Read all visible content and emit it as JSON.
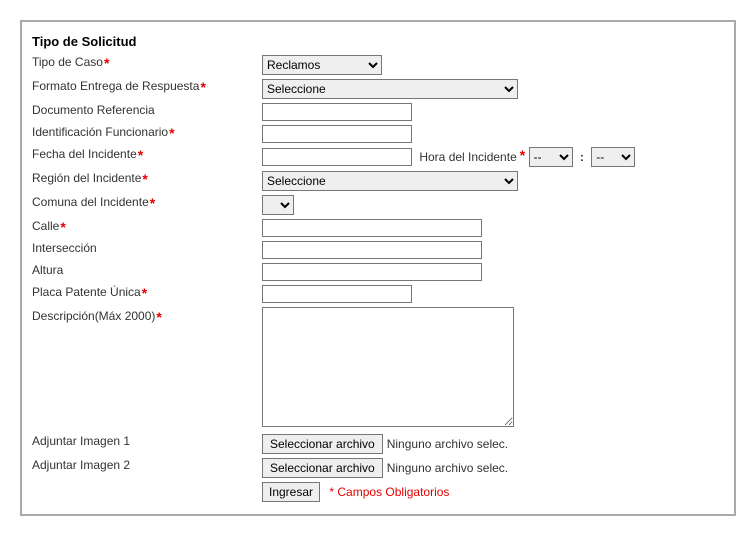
{
  "section_title": "Tipo de Solicitud",
  "labels": {
    "tipo_caso": "Tipo de Caso",
    "formato_entrega": "Formato Entrega de Respuesta",
    "documento_ref": "Documento Referencia",
    "id_funcionario": "Identificación Funcionario",
    "fecha_incidente": "Fecha del Incidente",
    "hora_incidente": "Hora del Incidente",
    "region_incidente": "Región del Incidente",
    "comuna_incidente": "Comuna del Incidente",
    "calle": "Calle",
    "interseccion": "Intersección",
    "altura": "Altura",
    "placa": "Placa Patente Única",
    "descripcion": "Descripción(Máx 2000)",
    "adj_img1": "Adjuntar Imagen 1",
    "adj_img2": "Adjuntar Imagen 2"
  },
  "values": {
    "tipo_caso_selected": "Reclamos",
    "formato_entrega_selected": "Seleccione",
    "documento_ref": "",
    "id_funcionario": "",
    "fecha_incidente": "",
    "hora_hh_selected": "--",
    "hora_mm_selected": "--",
    "region_selected": "Seleccione",
    "comuna_selected": "",
    "calle": "",
    "interseccion": "",
    "altura": "",
    "placa": "",
    "descripcion": ""
  },
  "file": {
    "button_label": "Seleccionar archivo",
    "no_file_text": "Ninguno archivo selec."
  },
  "submit_label": "Ingresar",
  "required_note": "* Campos Obligatorios",
  "asterisk": "*",
  "time_separator": ":"
}
